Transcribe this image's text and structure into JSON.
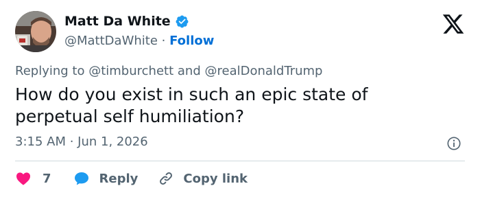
{
  "tweet": {
    "author": {
      "name": "Matt Da White",
      "handle": "@MattDaWhite",
      "separator": "·",
      "follow_label": "Follow"
    },
    "replying_to": {
      "prefix": "Replying to",
      "mentions": [
        "@timburchett",
        "@realDonaldTrump"
      ],
      "conjunction": "and"
    },
    "text_lines": [
      "How do you exist in such an epic state of",
      "perpetual self humiliation?"
    ],
    "timestamp": "3:15 AM · Jun 1, 2026",
    "actions": {
      "like_count": "7",
      "reply_label": "Reply",
      "copy_link_label": "Copy link"
    }
  },
  "colors": {
    "text_primary": "#0f1419",
    "text_secondary": "#536471",
    "follow_blue": "#006fd6",
    "verified_blue": "#1d9bf0",
    "like_pink": "#f91880",
    "divider": "#cfd9de"
  },
  "icons": {
    "verified": "verified-badge-icon",
    "x_logo": "x-logo-icon",
    "info": "info-icon",
    "like": "heart-icon",
    "reply": "speech-bubble-icon",
    "copy_link": "link-icon"
  }
}
